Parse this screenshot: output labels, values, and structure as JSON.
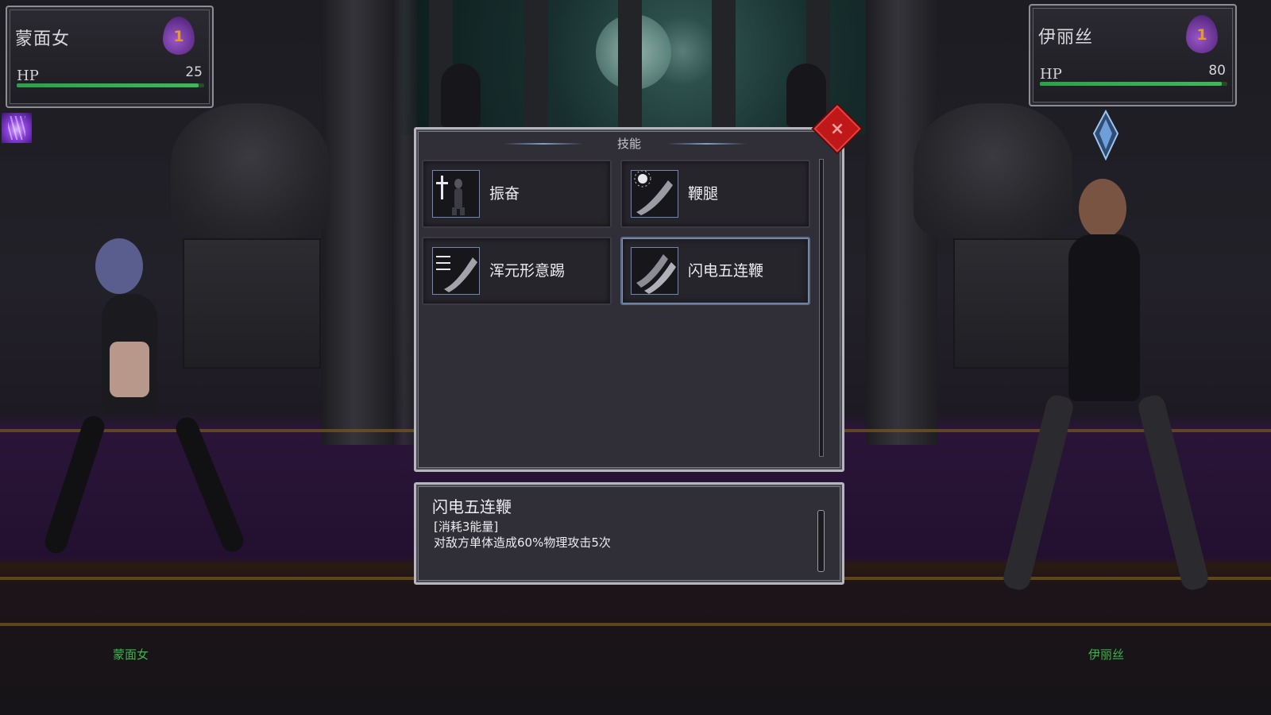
{
  "left_fighter": {
    "name": "蒙面女",
    "energy": "1",
    "hp_label": "HP",
    "hp": "25",
    "hp_fraction": 0.97,
    "floor_label": "蒙面女",
    "buff_icon": "purple-burst-icon"
  },
  "right_fighter": {
    "name": "伊丽丝",
    "energy": "1",
    "hp_label": "HP",
    "hp": "80",
    "hp_fraction": 0.97,
    "floor_label": "伊丽丝",
    "buff_icon": "blue-crystal-icon"
  },
  "skills_window": {
    "title": "技能",
    "close_icon": "close-x-icon",
    "skills": [
      {
        "label": "振奋",
        "icon": "rally-figure-icon",
        "selected": false
      },
      {
        "label": "鞭腿",
        "icon": "whip-kick-icon",
        "selected": false
      },
      {
        "label": "浑元形意踢",
        "icon": "flurry-kick-icon",
        "selected": false
      },
      {
        "label": "闪电五连鞭",
        "icon": "lightning-kick-icon",
        "selected": true
      }
    ]
  },
  "description": {
    "title": "闪电五连鞭",
    "cost": "[消耗3能量]",
    "effect": "对敌方单体造成60%物理攻击5次"
  },
  "colors": {
    "hp_bar": "#3fb85a",
    "energy_drop": "#8a4bc0",
    "energy_number": "#e39c2a",
    "close_button": "#c01818",
    "floor_name": "#3cb54a"
  }
}
